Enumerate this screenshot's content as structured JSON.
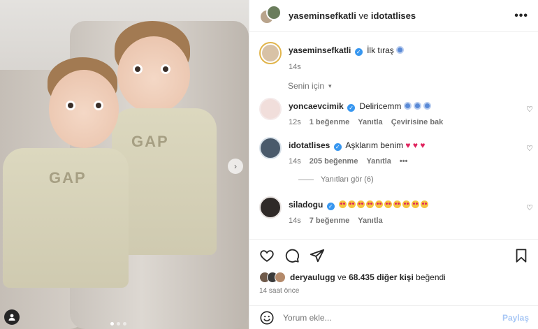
{
  "header": {
    "user1": "yaseminsefkatli",
    "conj": "ve",
    "user2": "idotatlises",
    "more_icon": "more-horizontal-icon"
  },
  "caption": {
    "username": "yaseminsefkatli",
    "text": "İlk tıraş",
    "time": "14s"
  },
  "filter_label": "Senin için",
  "comments": [
    {
      "username": "yoncaevcimik",
      "text": "Deliricemm",
      "time": "12s",
      "likes": "1 beğenme",
      "reply": "Yanıtla",
      "translate": "Çevirisine bak"
    },
    {
      "username": "idotatlises",
      "text": "Aşklarım benim",
      "time": "14s",
      "likes": "205 beğenme",
      "reply": "Yanıtla",
      "more": "•••"
    },
    {
      "username": "siladogu",
      "text": "",
      "time": "14s",
      "likes": "7 beğenme",
      "reply": "Yanıtla"
    }
  ],
  "view_replies": "Yanıtları gör (6)",
  "likes": {
    "user": "deryaulugg",
    "conj": "ve",
    "count": "68.435 diğer kişi",
    "suffix": "beğendi"
  },
  "time_ago": "14 saat önce",
  "add_comment": {
    "placeholder": "Yorum ekle...",
    "share": "Paylaş"
  },
  "media": {
    "print_text": "GAP"
  },
  "colors": {
    "verified": "#3897f0",
    "ring": "#e1b54c",
    "share": "#a8c7f5"
  }
}
